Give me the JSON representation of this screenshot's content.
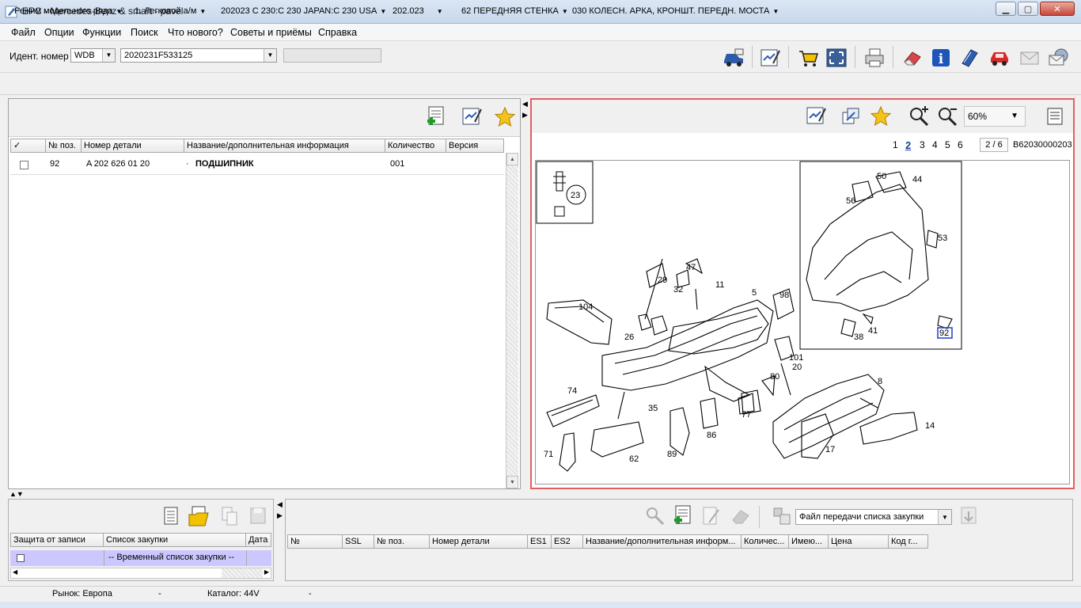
{
  "window": {
    "title": "EPC - Mercedes-Benz & smart - pavel"
  },
  "menu": [
    "Файл",
    "Опции",
    "Функции",
    "Поиск",
    "Что нового?",
    "Советы и приёмы",
    "Справка"
  ],
  "ident": {
    "label": "Идент. номер",
    "prefix": "WDB",
    "vin": "2020231F533125"
  },
  "breadcrumbs": [
    "Режим модельного ряда",
    "1. Легковой а/м",
    "202023 C 230:C 230 JAPAN:C 230 USA",
    "202.023",
    "62 ПЕРЕДНЯЯ СТЕНКА",
    "030 КОЛЕСН. АРКА, КРОНШТ. ПЕРЕДН. МОСТА"
  ],
  "parts_table": {
    "headers": [
      "✓",
      "№ поз.",
      "Номер детали",
      "Название/дополнительная информация",
      "Количество",
      "Версия"
    ],
    "rows": [
      {
        "pos": "92",
        "part_no": "A 202 626 01 20",
        "bullet": "·",
        "name": "ПОДШИПНИК",
        "qty": "001",
        "version": ""
      }
    ]
  },
  "diagram": {
    "zoom": "60%",
    "pages": [
      "1",
      "2",
      "3",
      "4",
      "5",
      "6"
    ],
    "current_page": "2",
    "page_indicator": "2 / 6",
    "image_code": "B62030000203",
    "callouts": [
      "23",
      "50",
      "44",
      "56",
      "53",
      "47",
      "29",
      "32",
      "11",
      "5",
      "98",
      "104",
      "26",
      "101",
      "20",
      "80",
      "8",
      "74",
      "35",
      "77",
      "86",
      "14",
      "71",
      "62",
      "89",
      "17",
      "41",
      "38",
      "92"
    ]
  },
  "purchase_lists": {
    "headers": [
      "Защита от записи",
      "Список закупки",
      "Дата"
    ],
    "row": "-- Временный список закупки --"
  },
  "purchase_items": {
    "transfer_select": "Файл передачи списка закупки",
    "headers": [
      "№",
      "SSL",
      "№ поз.",
      "Номер детали",
      "ES1",
      "ES2",
      "Название/дополнительная информ...",
      "Количес...",
      "Имею...",
      "Цена",
      "Код г..."
    ]
  },
  "status": {
    "market": "Рынок: Европа",
    "dash1": "-",
    "catalog": "Каталог: 44V",
    "dash2": "-"
  }
}
